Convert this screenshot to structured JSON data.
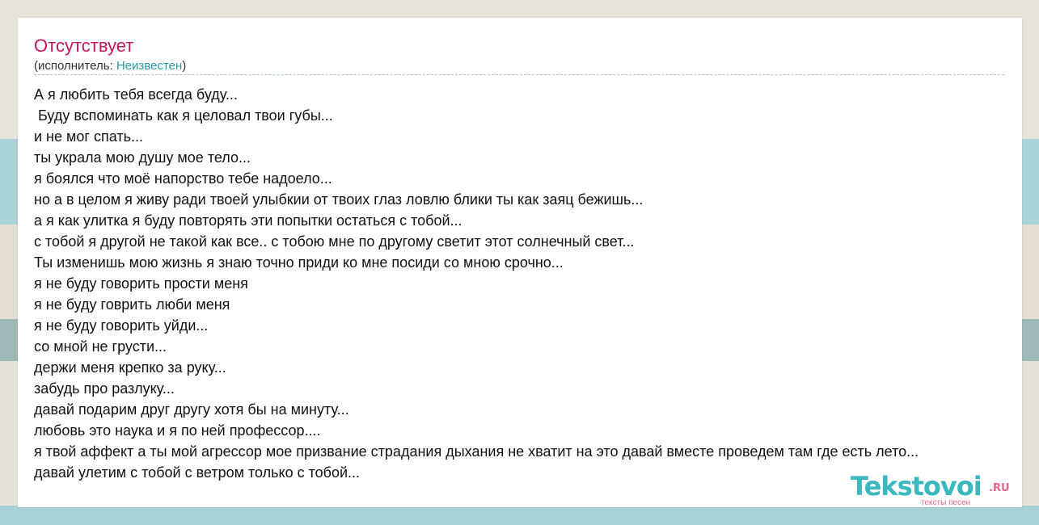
{
  "song": {
    "title": "Отсутствует",
    "artist_prefix": "(исполнитель: ",
    "artist_name": "Неизвестен",
    "artist_suffix": ")"
  },
  "lyrics": [
    "А я любить тебя всегда буду...",
    " Буду вспоминать как я целовал твои губы...",
    "и не мог спать...",
    "ты украла мою душу мое тело...",
    "я боялся что моё напорство тебе надоело...",
    "но а в целом я живу ради твоей улыбкии от твоих глаз ловлю блики ты как заяц бежишь...",
    "а я как улитка я буду повторять эти попытки остаться с тобой...",
    "с тобой я другой не такой как все.. с тобою мне по другому светит этот солнечный свет...",
    "Ты изменишь мою жизнь я знаю точно приди ко мне посиди со мною срочно...",
    "я не буду говорить прости меня",
    "я не буду говрить люби меня",
    "я не буду говорить уйди...",
    "со мной не грусти...",
    "держи меня крепко за руку...",
    "забудь про разлуку...",
    "давай подарим друг другу хотя бы на минуту...",
    "любовь это наука и я по ней профессор....",
    "я твой аффект а ты мой агрессор мое призвание страдания дыхания не хватит на это давай вместе проведем там где есть лето...",
    "давай улетим с тобой с ветром только с тобой..."
  ],
  "logo": {
    "main": "Tekstovoi",
    "tld": ".RU",
    "tagline": "тексты песен"
  },
  "colors": {
    "title": "#c2185b",
    "link": "#2a9aa5",
    "logo_main": "#3ab7bf",
    "logo_accent": "#e3658d"
  }
}
